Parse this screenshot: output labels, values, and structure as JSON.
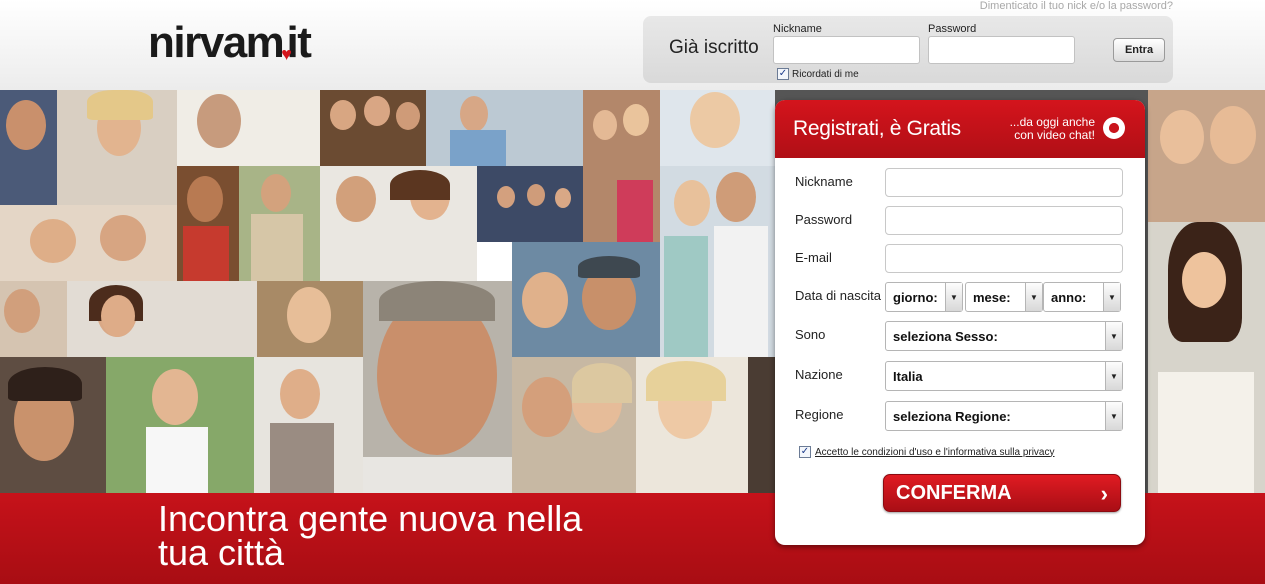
{
  "header": {
    "logo_text": "nirvam",
    "logo_suffix": "it",
    "forgot_link": "Dimenticato il tuo nick e/o la password?",
    "login": {
      "title": "Già iscritto",
      "nickname_label": "Nickname",
      "password_label": "Password",
      "nickname_value": "",
      "password_value": "",
      "submit_label": "Entra",
      "remember_label": "Ricordati di me",
      "remember_checked": true
    }
  },
  "registration": {
    "title": "Registrati, è Gratis",
    "promo_line1": "...da oggi anche",
    "promo_line2": "con video chat!",
    "fields": {
      "nickname_label": "Nickname",
      "password_label": "Password",
      "email_label": "E-mail",
      "birthdate_label": "Data di nascita",
      "day_value": "giorno:",
      "month_value": "mese:",
      "year_value": "anno:",
      "gender_label": "Sono",
      "gender_value": "seleziona Sesso:",
      "country_label": "Nazione",
      "country_value": "Italia",
      "region_label": "Regione",
      "region_value": "seleziona Regione:"
    },
    "terms_label": "Accetto le condizioni d'uso e l'informativa sulla privacy",
    "terms_checked": true,
    "submit_label": "CONFERMA"
  },
  "tagline_line1": "Incontra gente nuova nella",
  "tagline_line2": "tua città",
  "colors": {
    "brand_red": "#c6121a",
    "heart_red": "#d4141c"
  }
}
